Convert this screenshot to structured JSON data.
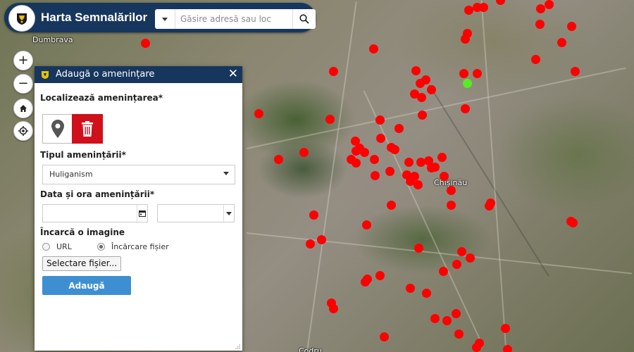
{
  "app": {
    "title": "Harta Semnalărilor"
  },
  "search": {
    "placeholder": "Găsire adresă sau loc"
  },
  "map": {
    "labels": {
      "city": "Chișinău",
      "district": "Dumbrava",
      "bottom": "Codru"
    },
    "colors": {
      "report": "#ff0000",
      "selected": "#55ee22"
    },
    "report_count": 88
  },
  "controls": {
    "zoom_in": "+",
    "zoom_out": "−"
  },
  "panel": {
    "title": "Adaugă o amenințare",
    "close": "✕",
    "locate_label": "Localizează amenințarea*",
    "threat_type_label": "Tipul amenințării*",
    "threat_type_value": "Huliganism",
    "datetime_label": "Data și ora amenințării*",
    "image_label": "Încarcă o imagine",
    "radio_url": "URL",
    "radio_upload": "Încărcare fișier",
    "radio_selected": "Încărcare fișier",
    "file_button": "Selectare fișier...",
    "submit": "Adaugă",
    "colors": {
      "header": "#17365d",
      "delete": "#d0101a",
      "submit": "#3d8fd1"
    }
  }
}
